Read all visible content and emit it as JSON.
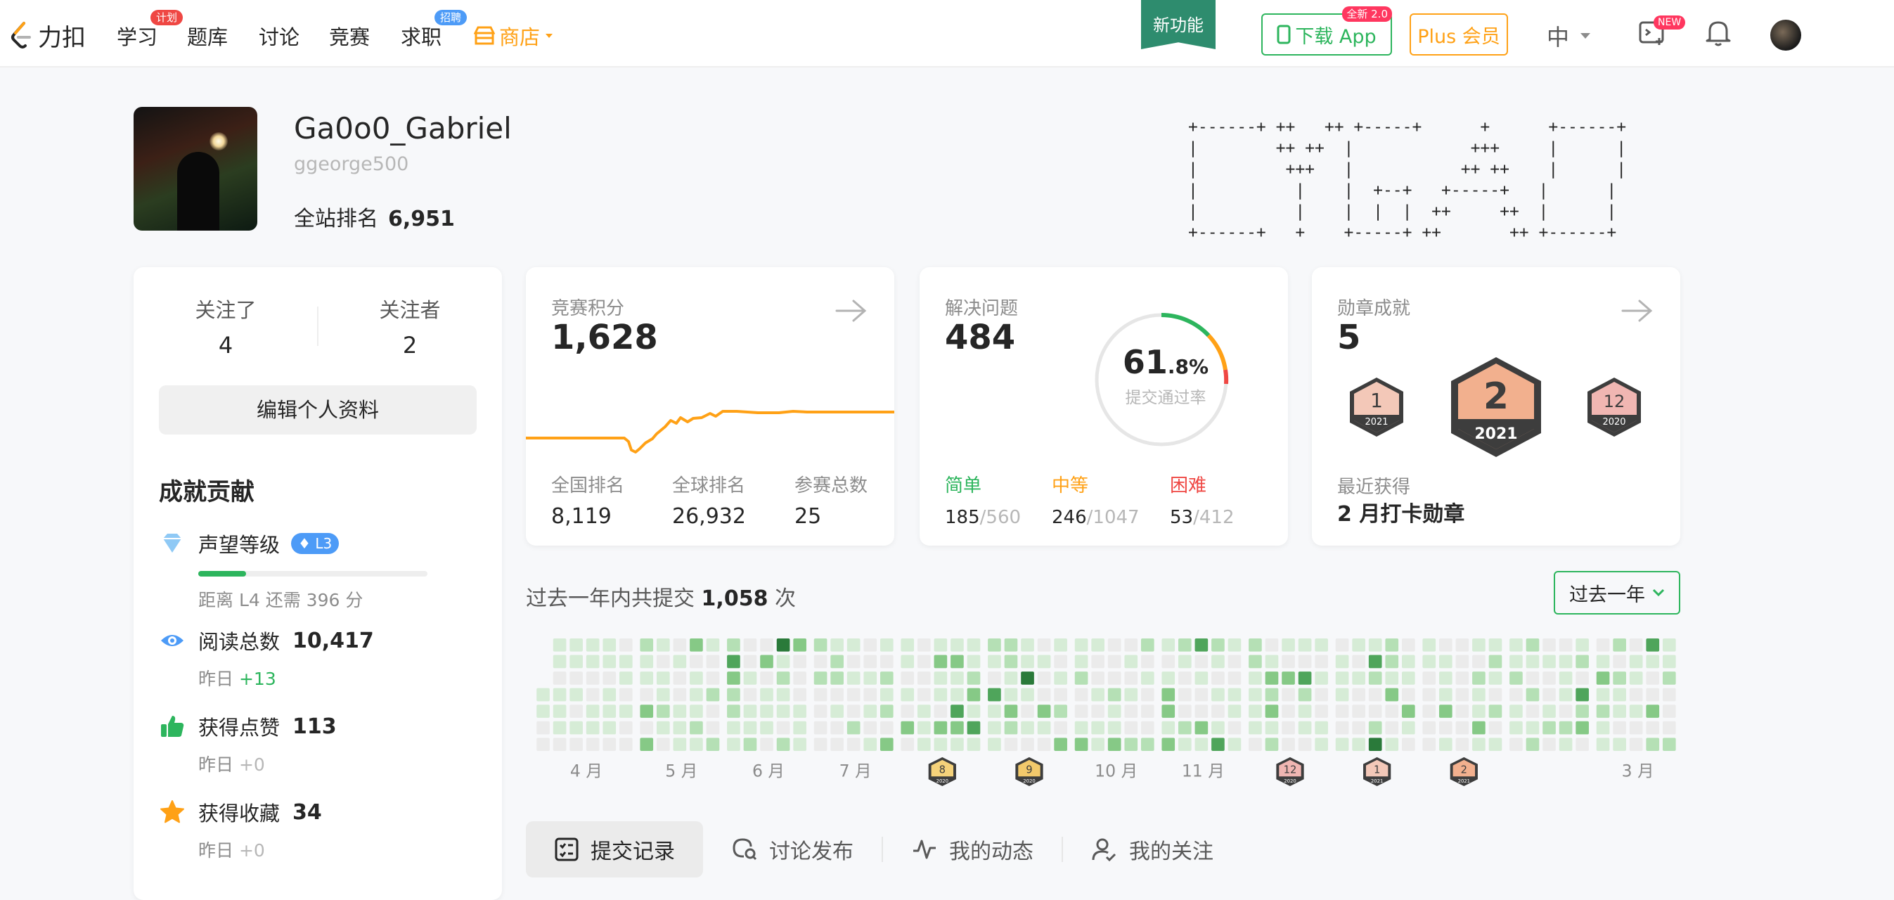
{
  "nav": {
    "logo_text": "力扣",
    "items": [
      {
        "label": "学习",
        "badge": "计划",
        "badge_color": "#ef4743"
      },
      {
        "label": "题库"
      },
      {
        "label": "讨论"
      },
      {
        "label": "竞赛"
      },
      {
        "label": "求职",
        "badge": "招聘",
        "badge_color": "#4d9bf7"
      }
    ],
    "shop_label": "商店",
    "new_feature": "新功能",
    "download_app": "下载 App",
    "download_badge": "全新 2.0",
    "plus_label": "Plus 会员",
    "lang": "中",
    "new_badge": "NEW"
  },
  "profile": {
    "username": "Ga0o0_Gabriel",
    "handle": "ggeorge500",
    "rank_label": "全站排名",
    "rank_value": "6,951",
    "ascii_art": "+------+ ++   ++ +-----+      +      +------+\n|        ++ ++  |            +++     |      |\n|         +++   |           ++ ++    |      |\n|          |    |  +--+   +-----+   |      |\n|          |    |  |  |  ++     ++  |      |\n+------+   +    +-----+ ++       ++ +------+"
  },
  "follow": {
    "following_label": "关注了",
    "following_value": "4",
    "followers_label": "关注者",
    "followers_value": "2",
    "edit_button": "编辑个人资料"
  },
  "achievements": {
    "title": "成就贡献",
    "reputation": {
      "label": "声望等级",
      "level": "L3",
      "progress_percent": 21,
      "next_text": "距离 L4 还需 396 分"
    },
    "reads": {
      "label": "阅读总数",
      "value": "10,417",
      "yesterday_label": "昨日",
      "yesterday_value": "+13"
    },
    "likes": {
      "label": "获得点赞",
      "value": "113",
      "yesterday_label": "昨日",
      "yesterday_value": "+0"
    },
    "favorites": {
      "label": "获得收藏",
      "value": "34",
      "yesterday_label": "昨日",
      "yesterday_value": "+0"
    }
  },
  "contest": {
    "title": "竞赛积分",
    "value": "1,628",
    "national_rank_label": "全国排名",
    "national_rank": "8,119",
    "global_rank_label": "全球排名",
    "global_rank": "26,932",
    "contests_label": "参赛总数",
    "contests": "25",
    "line_color": "#ffa116"
  },
  "solved": {
    "title": "解决问题",
    "value": "484",
    "rate_int": "61",
    "rate_dec": ".8%",
    "rate_label": "提交通过率",
    "easy_label": "简单",
    "easy_solved": "185",
    "easy_total": "/560",
    "easy_color": "#2db55d",
    "medium_label": "中等",
    "medium_solved": "246",
    "medium_total": "/1047",
    "medium_color": "#ffa116",
    "hard_label": "困难",
    "hard_solved": "53",
    "hard_total": "/412",
    "hard_color": "#ef4743"
  },
  "badges": {
    "title": "勋章成就",
    "count": "5",
    "items": [
      {
        "num": "1",
        "year": "2021"
      },
      {
        "num": "2",
        "year": "2021"
      },
      {
        "num": "12",
        "year": "2020"
      }
    ],
    "recent_label": "最近获得",
    "recent_value": "2 月打卡勋章"
  },
  "submissions": {
    "prefix": "过去一年内共提交",
    "count": "1,058",
    "suffix": "次",
    "range_label": "过去一年",
    "months": [
      "4 月",
      "5 月",
      "6 月",
      "7 月",
      "10 月",
      "11 月",
      "3 月"
    ],
    "month_badges": [
      {
        "num": "8",
        "year": "2020"
      },
      {
        "num": "9",
        "year": "2020"
      },
      {
        "num": "12",
        "year": "2020"
      },
      {
        "num": "1",
        "year": "2021"
      },
      {
        "num": "2",
        "year": "2021"
      }
    ],
    "colors": [
      "#ebebeb",
      "#d6ecd6",
      "#b5e0b5",
      "#86c986",
      "#4fa55b",
      "#2a7a3a"
    ]
  },
  "tabs": [
    {
      "label": "提交记录",
      "active": true
    },
    {
      "label": "讨论发布"
    },
    {
      "label": "我的动态"
    },
    {
      "label": "我的关注"
    }
  ]
}
